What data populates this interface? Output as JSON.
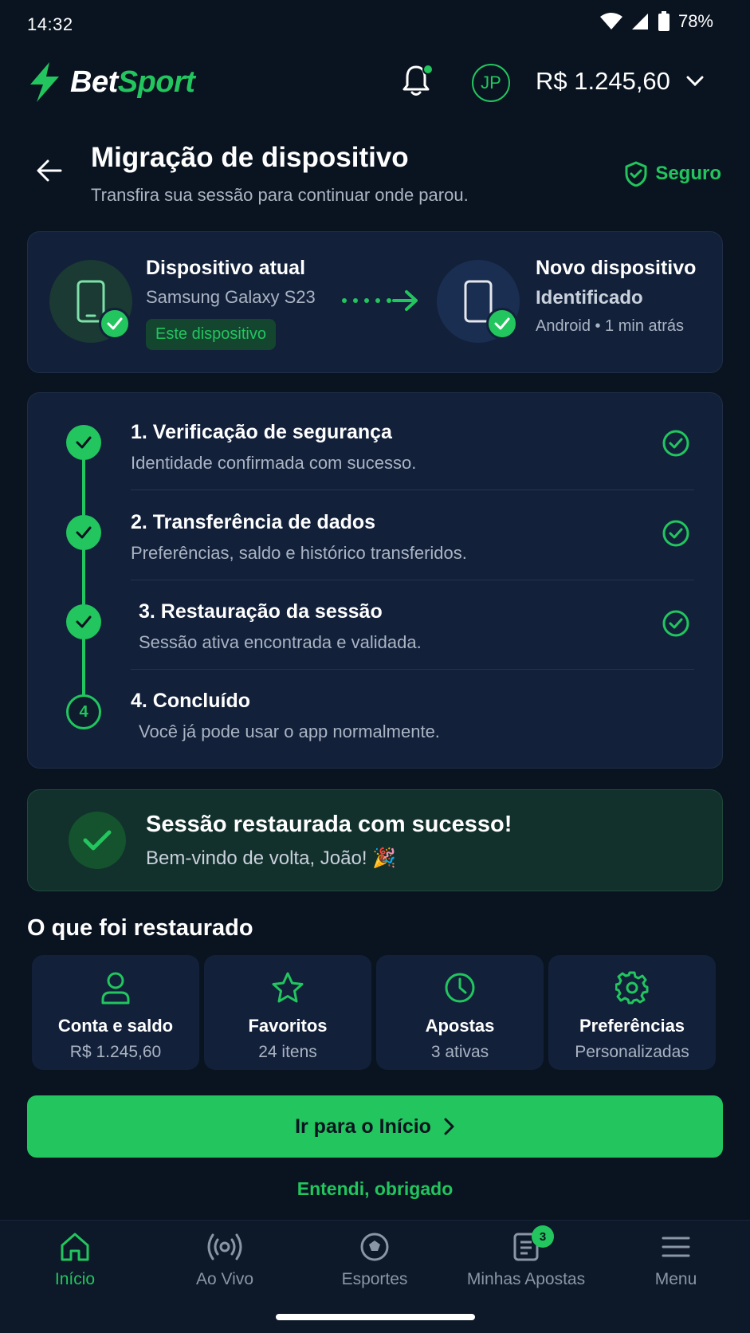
{
  "status_bar": {
    "time": "14:32",
    "battery": "78%"
  },
  "header": {
    "logo_part1": "Bet",
    "logo_part2": "Sport",
    "avatar_initials": "JP",
    "balance": "R$ 1.245,60"
  },
  "page": {
    "title": "Migração de dispositivo",
    "subtitle": "Transfira sua sessão para continuar onde parou.",
    "secure_label": "Seguro"
  },
  "devices": {
    "current": {
      "title": "Dispositivo atual",
      "model": "Samsung Galaxy S23",
      "tag": "Este dispositivo"
    },
    "new": {
      "title": "Novo dispositivo",
      "status": "Identificado",
      "meta": "Android • 1 min atrás"
    }
  },
  "steps": [
    {
      "title": "1. Verificação de segurança",
      "sub": "Identidade confirmada com sucesso.",
      "done": true
    },
    {
      "title": "2. Transferência de dados",
      "sub": "Preferências, saldo e histórico transferidos.",
      "done": true
    },
    {
      "title": "3. Restauração da sessão",
      "sub": "Sessão ativa encontrada e validada.",
      "done": true
    },
    {
      "title": "4. Concluído",
      "sub": "Você já pode usar o app normalmente.",
      "done": false,
      "number": "4"
    }
  ],
  "success": {
    "title": "Sessão restaurada com sucesso!",
    "sub": "Bem-vindo de volta, João! 🎉"
  },
  "restored": {
    "title": "O que foi restaurado",
    "items": [
      {
        "icon": "user-icon",
        "title": "Conta e saldo",
        "sub": "R$ 1.245,60"
      },
      {
        "icon": "star-icon",
        "title": "Favoritos",
        "sub": "24 itens"
      },
      {
        "icon": "clock-icon",
        "title": "Apostas",
        "sub": "3 ativas"
      },
      {
        "icon": "gear-icon",
        "title": "Preferências",
        "sub": "Personalizadas"
      }
    ]
  },
  "actions": {
    "primary": "Ir para o Início",
    "secondary": "Entendi, obrigado"
  },
  "bottom_nav": {
    "items": [
      {
        "label": "Início",
        "icon": "home-icon",
        "active": true
      },
      {
        "label": "Ao Vivo",
        "icon": "live-icon"
      },
      {
        "label": "Esportes",
        "icon": "ball-icon"
      },
      {
        "label": "Minhas Apostas",
        "icon": "ticket-icon",
        "badge": "3"
      },
      {
        "label": "Menu",
        "icon": "menu-icon"
      }
    ]
  },
  "colors": {
    "accent": "#22c55e",
    "background": "#0a1420",
    "card": "#12203a"
  }
}
